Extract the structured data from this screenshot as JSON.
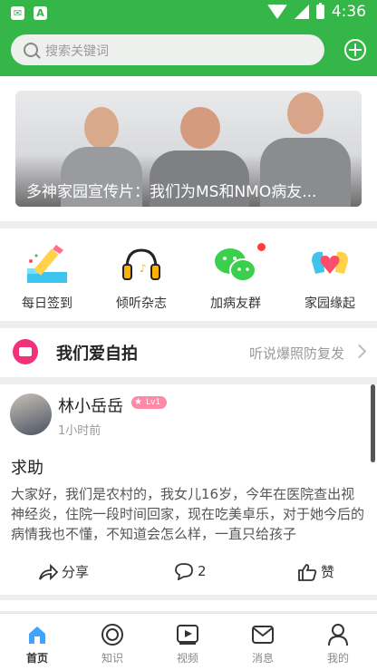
{
  "status": {
    "time": "4:36",
    "left_icons": [
      "mail-icon",
      "text-icon"
    ]
  },
  "header": {
    "search_placeholder": "搜索关键词",
    "add_icon": "plus-circle-icon"
  },
  "banner": {
    "caption": "多神家园宣传片：我们为MS和NMO病友..."
  },
  "quick_links": [
    {
      "label": "每日签到",
      "icon": "pencil-podium-icon"
    },
    {
      "label": "倾听杂志",
      "icon": "headphones-icon"
    },
    {
      "label": "加病友群",
      "icon": "wechat-icon"
    },
    {
      "label": "家园缘起",
      "icon": "heart-hands-icon"
    }
  ],
  "section": {
    "title": "我们爱自拍",
    "subtitle": "听说爆照防复发"
  },
  "post": {
    "author": "林小岳岳",
    "level": "Lv1",
    "time": "1小时前",
    "title": "求助",
    "body": "大家好，我们是农村的，我女儿16岁，今年在医院查出视神经炎，住院一段时间回家，现在吃美卓乐，对于她今后的病情我也不懂，不知道会怎么样，一直只给孩子",
    "share_label": "分享",
    "comment_count": "2",
    "like_label": "赞"
  },
  "tabs": [
    {
      "label": "首页",
      "icon": "home-icon",
      "active": true
    },
    {
      "label": "知识",
      "icon": "knowledge-icon",
      "active": false
    },
    {
      "label": "视频",
      "icon": "video-icon",
      "active": false
    },
    {
      "label": "消息",
      "icon": "message-icon",
      "active": false
    },
    {
      "label": "我的",
      "icon": "user-icon",
      "active": false
    }
  ],
  "colors": {
    "brand_green": "#35b649",
    "badge_pink": "#f1327b",
    "notify_red": "#ff3d3d"
  }
}
